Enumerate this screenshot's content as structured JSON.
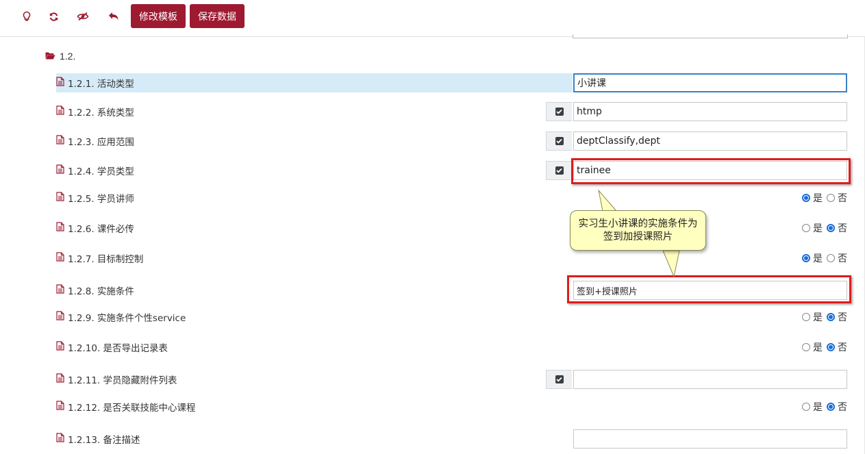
{
  "toolbar": {
    "icons": [
      "bulb-icon",
      "refresh-icon",
      "hide-icon",
      "undo-icon"
    ],
    "btn_edit_template": "修改模板",
    "btn_save_data": "保存数据"
  },
  "colors": {
    "brand": "#9e1a31",
    "highlight": "#d6ebf8",
    "annotation_red": "#e01b1b",
    "callout_bg": "#ffffbf",
    "radio_on": "#1a6dd6"
  },
  "folder": {
    "label": "1.2."
  },
  "radio_labels": {
    "yes": "是",
    "no": "否"
  },
  "rows": [
    {
      "label": "1.2.1. 活动类型",
      "value": "小讲课"
    },
    {
      "label": "1.2.2. 系统类型",
      "value": "htmp",
      "checked": true
    },
    {
      "label": "1.2.3. 应用范围",
      "value": "deptClassify,dept",
      "checked": true
    },
    {
      "label": "1.2.4. 学员类型",
      "value": "trainee",
      "checked": true
    },
    {
      "label": "1.2.5. 学员讲师",
      "radio": "是"
    },
    {
      "label": "1.2.6. 课件必传",
      "radio": "否"
    },
    {
      "label": "1.2.7. 目标制控制",
      "radio": "是"
    },
    {
      "label": "1.2.8. 实施条件",
      "value": "签到+授课照片"
    },
    {
      "label": "1.2.9. 实施条件个性service",
      "radio": "否"
    },
    {
      "label": "1.2.10. 是否导出记录表",
      "radio": "否"
    },
    {
      "label": "1.2.11. 学员隐藏附件列表",
      "value": "",
      "checked": true
    },
    {
      "label": "1.2.12. 是否关联技能中心课程",
      "radio": "否"
    },
    {
      "label": "1.2.13. 备注描述",
      "value": ""
    }
  ],
  "callout": {
    "text": "实习生小讲课的实施条件为签到加授课照片"
  }
}
